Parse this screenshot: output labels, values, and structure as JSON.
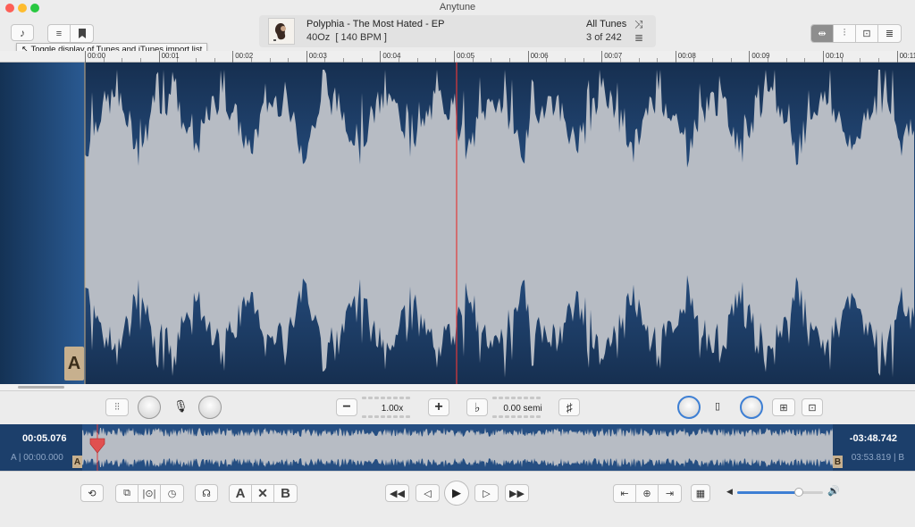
{
  "window": {
    "title": "Anytune"
  },
  "tooltip": {
    "text": "Toggle display of Tunes and iTunes import list"
  },
  "now_playing": {
    "track": "Polyphia - The Most Hated - EP",
    "subtitle": "40Oz",
    "bpm": "[ 140 BPM ]",
    "playlist": "All Tunes",
    "position": "3",
    "of_label": "of",
    "total": "242"
  },
  "ruler": {
    "labels": [
      "00:00",
      "00:01",
      "00:02",
      "00:03",
      "00:04",
      "00:05",
      "00:06",
      "00:07",
      "00:08",
      "00:09",
      "00:10",
      "00:11"
    ]
  },
  "markers": {
    "a": "A",
    "b": "B"
  },
  "controls": {
    "speed": "1.00x",
    "pitch": "0.00 semi",
    "minus": "−",
    "plus": "+",
    "flat": "♭",
    "sharp": "♯"
  },
  "overview": {
    "current_time": "00:05.076",
    "remaining_time": "-03:48.742",
    "a_marker_time": "A | 00:00.000",
    "b_marker_time": "03:53.819 | B"
  },
  "transport": {
    "loop_a": "A",
    "loop_clear": "✕",
    "loop_b": "B"
  },
  "volume": {
    "level": 0.72
  },
  "colors": {
    "waveform_bg": "#1c3f6b",
    "waveform_fg": "#b7bcc4",
    "playhead": "#e03a3a",
    "accent": "#3d7fd4"
  }
}
